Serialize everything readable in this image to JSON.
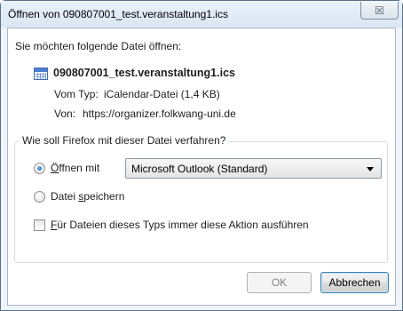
{
  "window": {
    "title": "Öffnen von 090807001_test.veranstaltung1.ics",
    "close_glyph": "☒"
  },
  "dialog": {
    "intro": "Sie möchten folgende Datei öffnen:",
    "file": {
      "icon": "calendar-file-icon",
      "name": "090807001_test.veranstaltung1.ics",
      "type_label": "Vom Typ:",
      "type_value": "iCalendar-Datei (1,4 KB)",
      "from_label": "Von:",
      "from_value": "https://organizer.folkwang-uni.de"
    },
    "action_group": {
      "legend": "Wie soll Firefox mit dieser Datei verfahren?",
      "open_with": {
        "label_prefix_accel": "Ö",
        "label_rest": "ffnen mit",
        "selected": true
      },
      "app_select": {
        "value": "Microsoft Outlook (Standard)"
      },
      "save_file": {
        "label_before": "Datei ",
        "label_accel": "s",
        "label_after": "peichern",
        "selected": false
      },
      "always": {
        "label_accel": "F",
        "label_rest": "ür Dateien dieses Typs immer diese Aktion ausführen",
        "checked": false
      }
    },
    "buttons": {
      "ok": "OK",
      "cancel": "Abbrechen"
    }
  }
}
